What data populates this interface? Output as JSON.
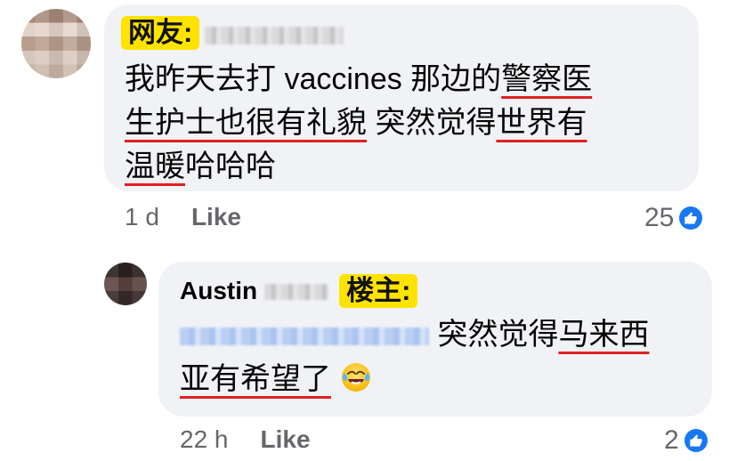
{
  "comments": [
    {
      "tag": "网友:",
      "text_prefix": "我昨天去打 vaccines 那边的",
      "text_underline_1": "警察医",
      "text_underline_2": "生护士也很有礼貌",
      "text_middle": " 突然觉得",
      "text_underline_3": "世界有",
      "text_underline_4": "温暖",
      "text_suffix": "哈哈哈",
      "time": "1 d",
      "like_label": "Like",
      "reaction_count": "25"
    },
    {
      "author_name": "Austin",
      "tag": "楼主:",
      "text_prefix": "突然觉得",
      "text_underline_1": "马来西",
      "text_underline_2": "亚有希望了",
      "emoji_name": "tears-of-joy",
      "time": "22 h",
      "like_label": "Like",
      "reaction_count": "2"
    }
  ],
  "colors": {
    "bubble_bg": "#f0f2f5",
    "tag_yellow": "#ffe300",
    "underline_red": "#e02020",
    "like_blue": "#1877f2"
  }
}
